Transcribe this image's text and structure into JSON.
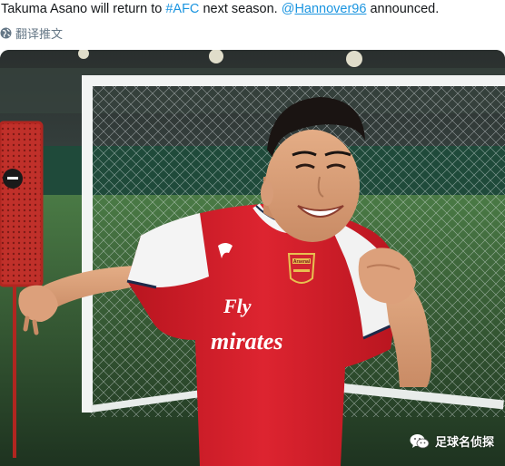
{
  "tweet": {
    "text_before": "Takuma Asano will return to ",
    "hashtag": "#AFC",
    "text_middle": " next season. ",
    "mention_at": "@",
    "mention_name": "Hannover96",
    "text_after": " announced.",
    "translate_label": "翻译推文"
  },
  "photo": {
    "jersey_sponsor_line1": "Fly",
    "jersey_sponsor_line2": "mirates",
    "crest_text": "Arsenal",
    "watermark_text": "足球名侦探"
  },
  "colors": {
    "link": "#1b95e0",
    "jersey_red": "#d5202b",
    "pitch_green": "#3f6a3c"
  }
}
